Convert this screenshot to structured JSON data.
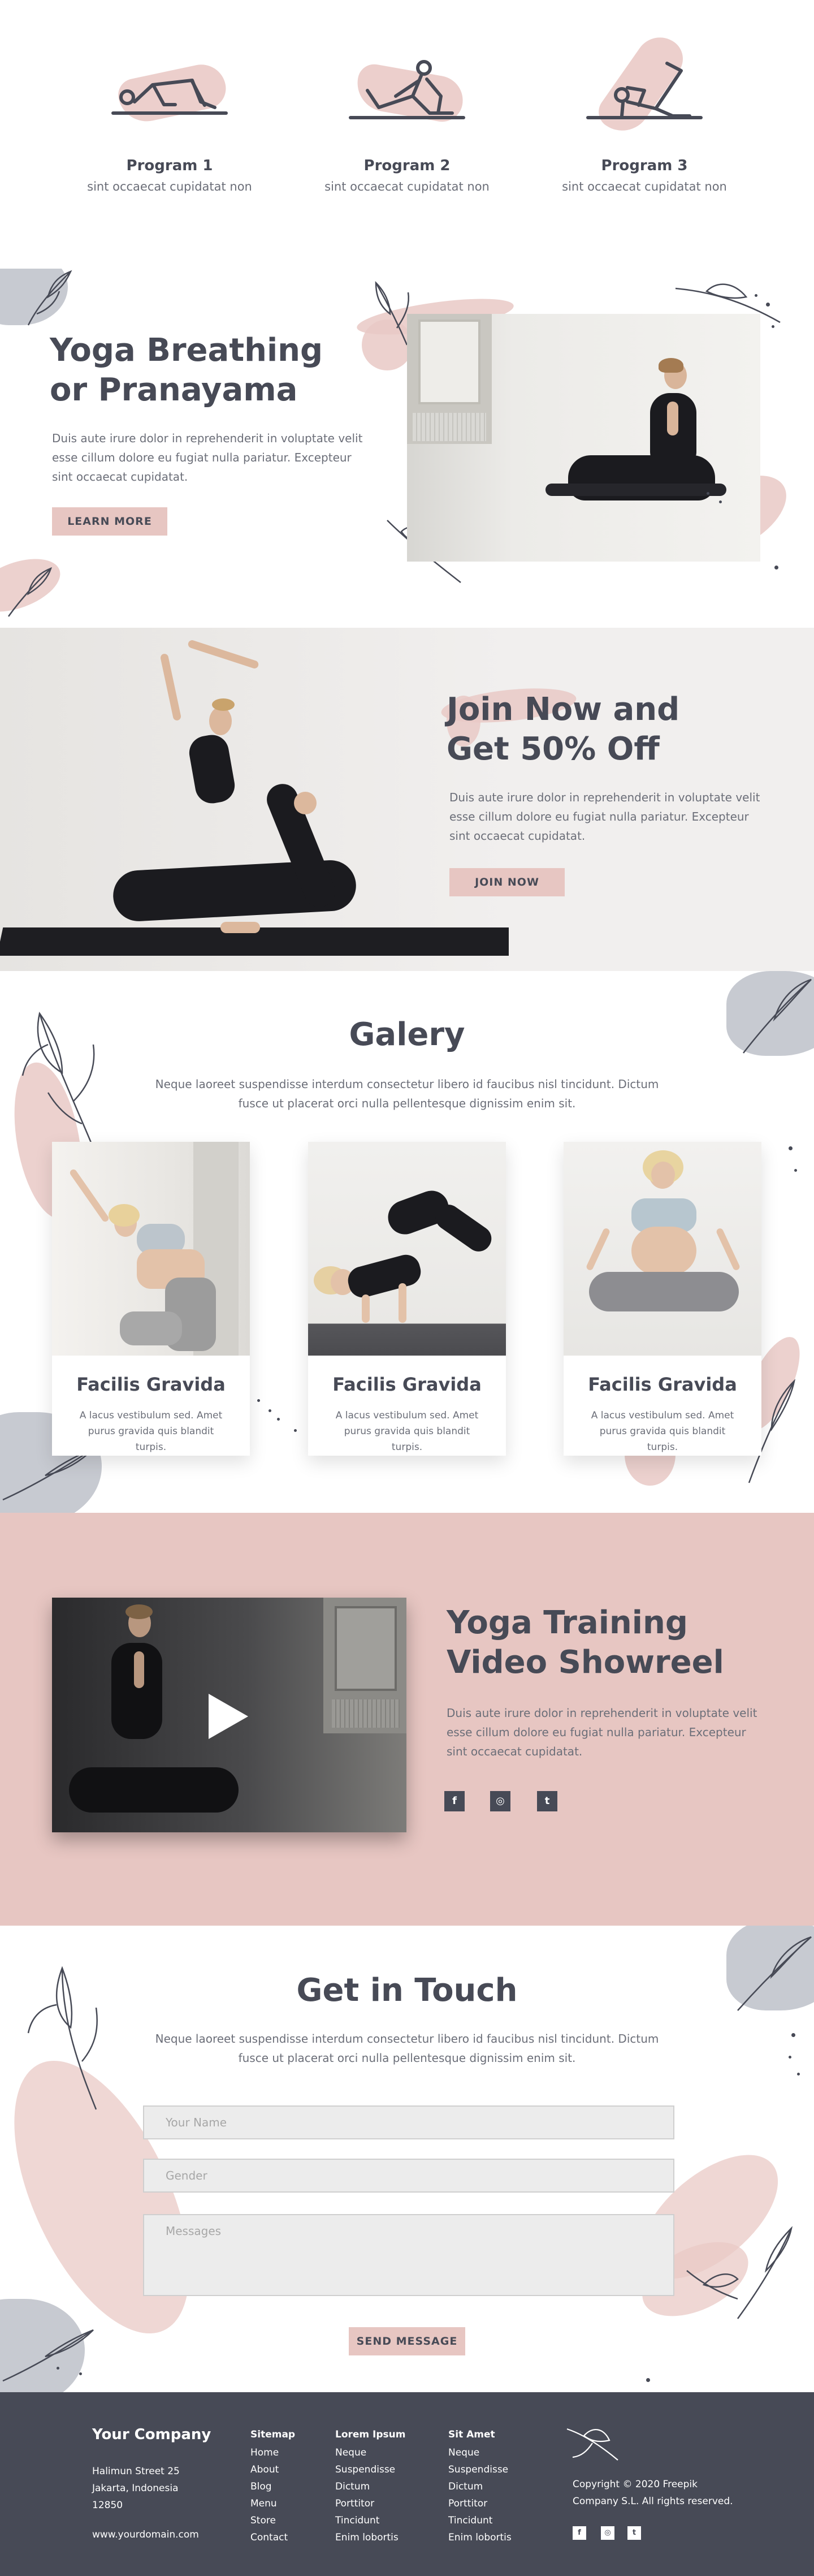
{
  "programs": [
    {
      "title": "Program 1",
      "subtitle": "sint occaecat cupidatat non",
      "icon": "yoga-pose-bridge-icon"
    },
    {
      "title": "Program 2",
      "subtitle": "sint occaecat cupidatat non",
      "icon": "yoga-pose-seated-stretch-icon"
    },
    {
      "title": "Program 3",
      "subtitle": "sint occaecat cupidatat non",
      "icon": "yoga-pose-leg-raise-icon"
    }
  ],
  "pranayama": {
    "title_line1": "Yoga Breathing",
    "title_line2": "or Pranayama",
    "text": "Duis aute irure dolor in reprehenderit in voluptate velit esse cillum dolore eu fugiat nulla pariatur. Excepteur sint occaecat cupidatat.",
    "button": "LEARN MORE"
  },
  "join": {
    "title_line1": "Join Now and",
    "title_line2": "Get 50% Off",
    "text": "Duis aute irure dolor in reprehenderit in voluptate velit esse cillum dolore eu fugiat nulla pariatur. Excepteur sint occaecat cupidatat.",
    "button": "JOIN NOW"
  },
  "galery": {
    "title": "Galery",
    "text": "Neque laoreet suspendisse interdum consectetur libero id faucibus nisl tincidunt. Dictum fusce ut placerat orci nulla pellentesque dignissim enim sit.",
    "cards": [
      {
        "title": "Facilis Gravida",
        "text": "A lacus vestibulum sed. Amet purus gravida quis blandit turpis."
      },
      {
        "title": "Facilis Gravida",
        "text": "A lacus vestibulum sed. Amet purus gravida quis blandit turpis."
      },
      {
        "title": "Facilis Gravida",
        "text": "A lacus vestibulum sed. Amet purus gravida quis blandit turpis."
      }
    ]
  },
  "showreel": {
    "title_line1": "Yoga Training",
    "title_line2": "Video Showreel",
    "text": "Duis aute irure dolor in reprehenderit in voluptate velit esse cillum dolore eu fugiat nulla pariatur. Excepteur sint occaecat cupidatat.",
    "social": [
      {
        "glyph": "f",
        "icon": "facebook-icon"
      },
      {
        "glyph": "◎",
        "icon": "instagram-icon"
      },
      {
        "glyph": "t",
        "icon": "twitter-icon"
      }
    ]
  },
  "contact": {
    "title": "Get in Touch",
    "text": "Neque laoreet suspendisse interdum consectetur libero id faucibus nisl tincidunt. Dictum fusce ut placerat orci nulla pellentesque dignissim enim sit.",
    "name_placeholder": "Your Name",
    "gender_placeholder": "Gender",
    "messages_placeholder": "Messages",
    "button": "SEND MESSAGE"
  },
  "footer": {
    "brand": "Your Company",
    "address1": "Halimun Street 25",
    "address2": "Jakarta, Indonesia",
    "address3": "12850",
    "website": "www.yourdomain.com",
    "col1": {
      "heading": "Sitemap",
      "items": [
        "Home",
        "About",
        "Blog",
        "Menu",
        "Store",
        "Contact"
      ]
    },
    "col2": {
      "heading": "Lorem Ipsum",
      "items": [
        "Neque",
        "Suspendisse",
        "Dictum",
        "Porttitor",
        "Tincidunt",
        "Enim lobortis"
      ]
    },
    "col3": {
      "heading": "Sit Amet",
      "items": [
        "Neque",
        "Suspendisse",
        "Dictum",
        "Porttitor",
        "Tincidunt",
        "Enim lobortis"
      ]
    },
    "copyright1": "Copyright ©  2020 Freepik",
    "copyright2": "Company S.L. All rights reserved."
  },
  "colors": {
    "accent_pink": "#e7c6c2",
    "dark": "#474a56",
    "grey_blob": "#c7cad1"
  }
}
